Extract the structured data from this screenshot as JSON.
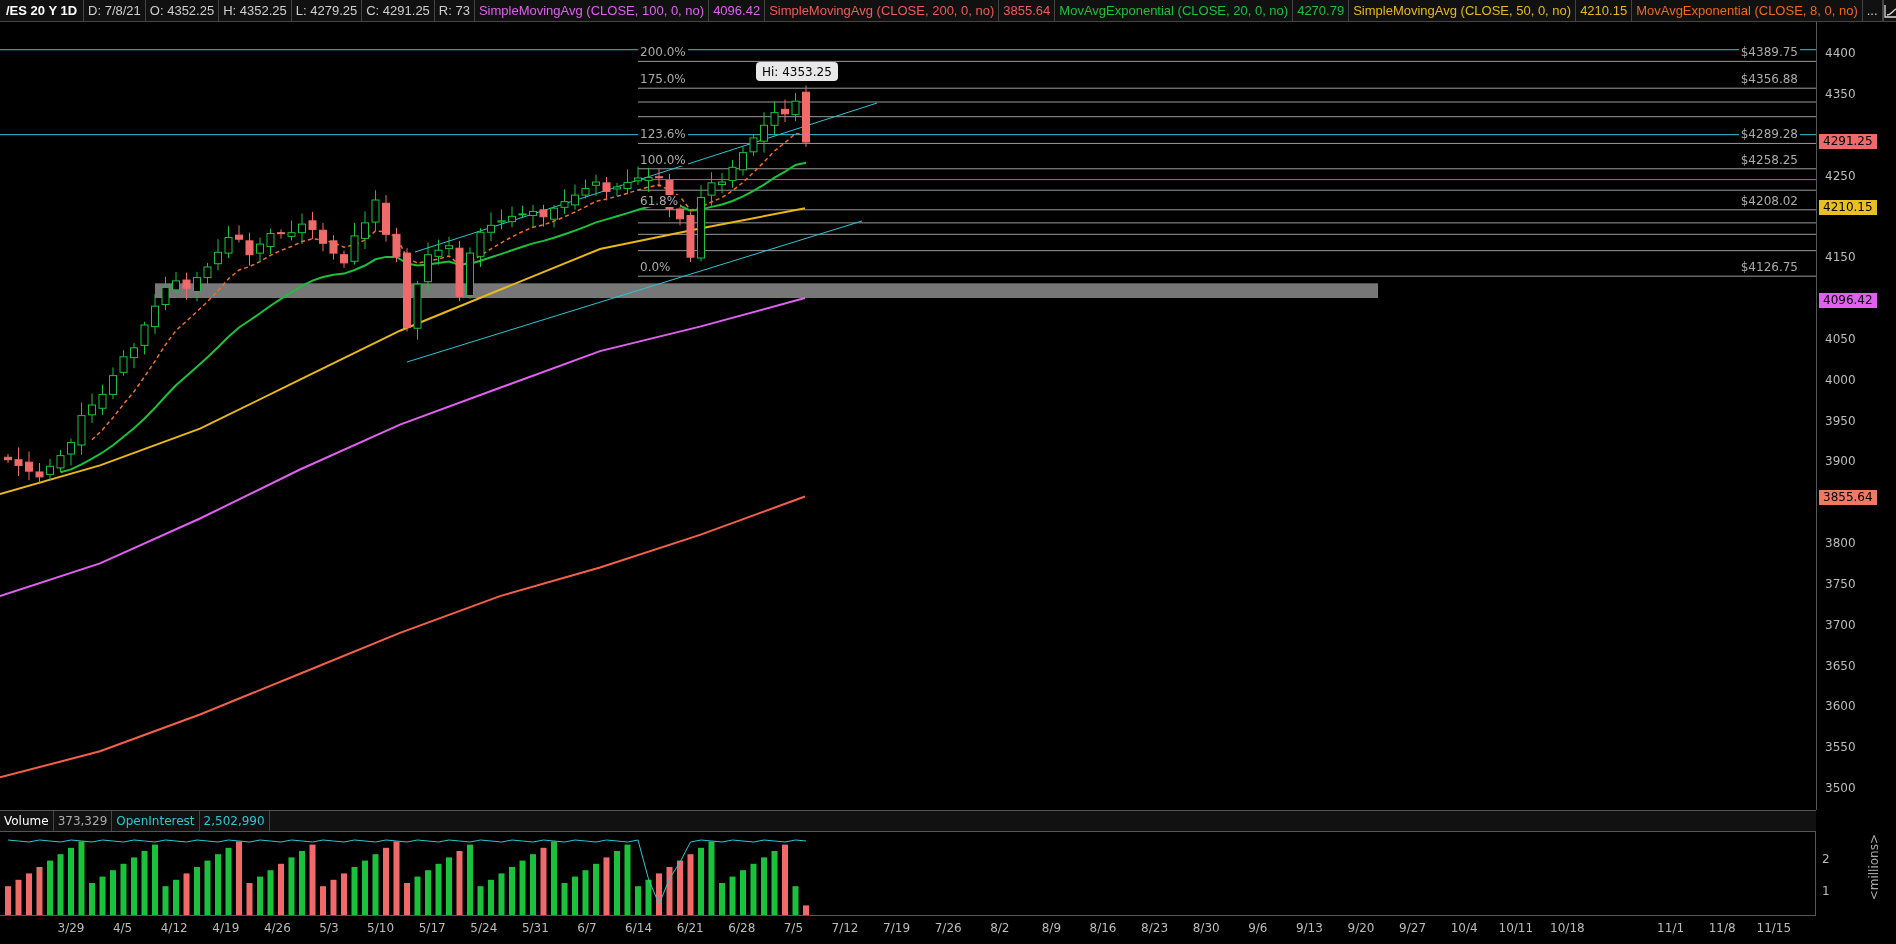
{
  "header": {
    "symbol": "/ES 20 Y 1D",
    "fields": [
      "D: 7/8/21",
      "O: 4352.25",
      "H: 4352.25",
      "L: 4279.25",
      "C: 4291.25",
      "R: 73"
    ],
    "studies": [
      {
        "label": "SimpleMovingAvg (CLOSE, 100, 0, no)",
        "value": "4096.42",
        "color": "#e060f0"
      },
      {
        "label": "SimpleMovingAvg (CLOSE, 200, 0, no)",
        "value": "3855.64",
        "color": "#f05a5a"
      },
      {
        "label": "MovAvgExponential (CLOSE, 20, 0, no)",
        "value": "4270.79",
        "color": "#19c23a"
      },
      {
        "label": "SimpleMovingAvg (CLOSE, 50, 0, no)",
        "value": "4210.15",
        "color": "#e8b818"
      },
      {
        "label": "MovAvgExponential (CLOSE, 8, 0, no)",
        "color": "#f06818"
      }
    ],
    "more": "..."
  },
  "price_chart": {
    "tooltip": "Hi: 4353.25",
    "fib_levels": [
      {
        "percent": "200.0%",
        "price": "$4389.75"
      },
      {
        "percent": "175.0%",
        "price": "$4356.88"
      },
      {
        "percent": "123.6%",
        "price": "$4289.28"
      },
      {
        "percent": "100.0%",
        "price": "$4258.25"
      },
      {
        "percent": "61.8%",
        "price": "$4208.02"
      },
      {
        "percent": "0.0%",
        "price": "$4126.75"
      }
    ],
    "y_axis": [
      "4400",
      "4350",
      "4250",
      "4150",
      "4050",
      "4000",
      "3950",
      "3900",
      "3800",
      "3750",
      "3700",
      "3650",
      "3600",
      "3550",
      "3500"
    ],
    "badges": [
      {
        "text": "4291.25",
        "color": "#f06a6a"
      },
      {
        "text": "4210.15",
        "color": "#e8c020"
      },
      {
        "text": "4096.42",
        "color": "#e060f0"
      },
      {
        "text": "3855.64",
        "color": "#f07a60"
      }
    ]
  },
  "volume_pane": {
    "labels": [
      {
        "name": "Volume",
        "value": "373,329"
      },
      {
        "name": "OpenInterest",
        "value": "2,502,990"
      }
    ],
    "y_axis": [
      "2",
      "1"
    ],
    "unit": "<millions>"
  },
  "x_axis": [
    "3/29",
    "4/5",
    "4/12",
    "4/19",
    "4/26",
    "5/3",
    "5/10",
    "5/17",
    "5/24",
    "5/31",
    "6/7",
    "6/14",
    "6/21",
    "6/28",
    "7/5",
    "7/12",
    "7/19",
    "7/26",
    "8/2",
    "8/9",
    "8/16",
    "8/23",
    "8/30",
    "9/6",
    "9/13",
    "9/20",
    "9/27",
    "10/4",
    "10/11",
    "10/18",
    "11/1",
    "11/8",
    "11/15"
  ]
}
